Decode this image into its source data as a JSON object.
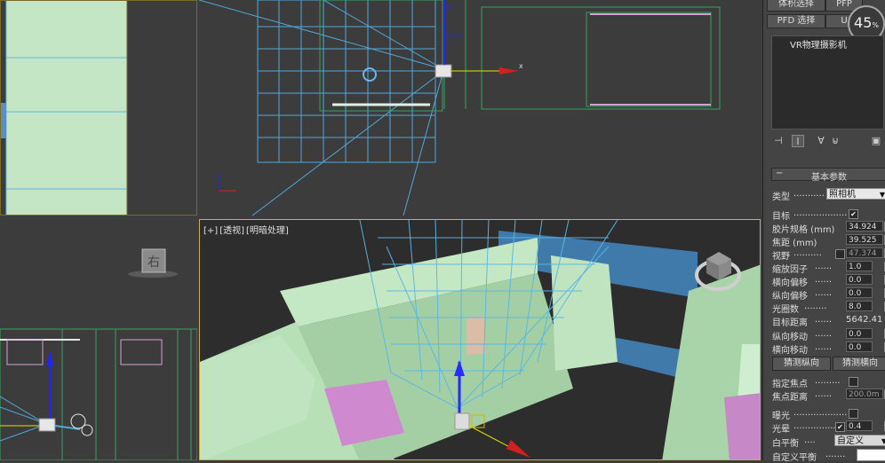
{
  "viewports": {
    "perspective_label": {
      "plus": "[+]",
      "view": "[透视]",
      "shading": "[明暗处理]"
    },
    "viewcube_label": "右"
  },
  "panel": {
    "top_buttons": {
      "volume_select": "体积选择",
      "pfd_select": "PFD 选择",
      "pfp": "PFP",
      "u": "U"
    },
    "zoom": {
      "value": "45",
      "unit": "%"
    },
    "object_list": [
      "VR物理摄影机"
    ],
    "rollout_title": "基本参数",
    "params": {
      "type_label": "类型",
      "type_value": "照相机",
      "target_label": "目标",
      "target_checked": "✔",
      "film_gate_label": "胶片规格 (mm)",
      "film_gate_value": "34.924",
      "focal_length_label": "焦距 (mm)",
      "focal_length_value": "39.525",
      "fov_label": "视野",
      "fov_value": "47.374",
      "zoom_factor_label": "缩放因子",
      "zoom_factor_value": "1.0",
      "h_shift_label": "横向偏移",
      "h_shift_value": "0.0",
      "v_shift_label": "纵向偏移",
      "v_shift_value": "0.0",
      "f_number_label": "光圈数",
      "f_number_value": "8.0",
      "target_distance_label": "目标距离",
      "target_distance_value": "5642.41",
      "v_tilt_label": "纵向移动",
      "v_tilt_value": "0.0",
      "h_tilt_label": "横向移动",
      "h_tilt_value": "0.0",
      "guess_vertical": "猜测纵向",
      "guess_horizontal": "猜测横向",
      "specify_focus_label": "指定焦点",
      "focus_distance_label": "焦点距离",
      "focus_distance_value": "200.0m",
      "exposure_label": "曝光",
      "vignetting_label": "光晕",
      "vignetting_checked": "✔",
      "vignetting_value": "0.4",
      "white_balance_label": "白平衡",
      "white_balance_value": "自定义",
      "custom_balance_label": "自定义平衡"
    }
  },
  "colors": {
    "wall": "#b9e0bd",
    "grid": "#58b8e6",
    "beam": "#3c78a8",
    "accent_pink": "#d48fd4",
    "viewport_border": "#c9b04a"
  }
}
